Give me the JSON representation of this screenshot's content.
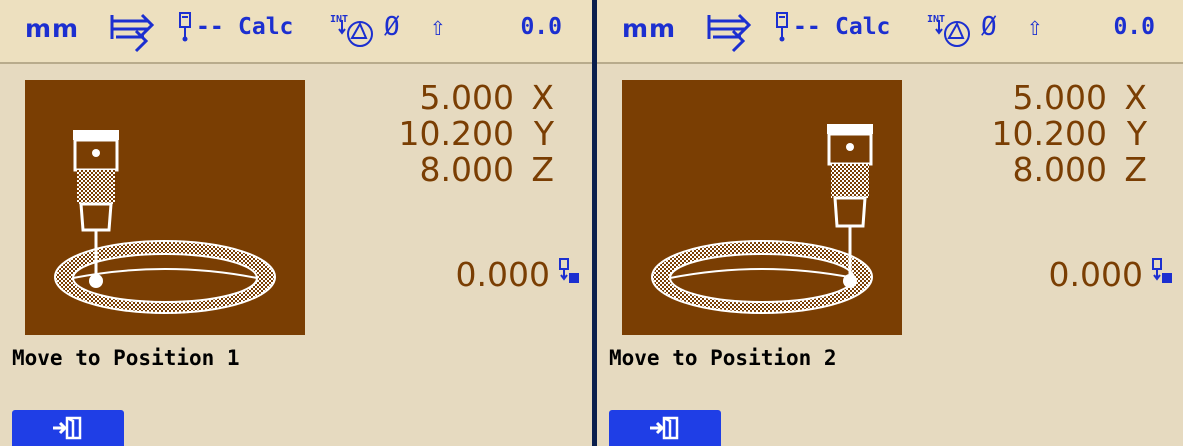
{
  "colors": {
    "panel_bg": "#e6dac0",
    "status_blue": "#1c2fd0",
    "readout_brown": "#7a3e03",
    "picture_bg": "#7a3e03",
    "softkey_blue": "#1f3ee6"
  },
  "panels": [
    {
      "status": {
        "unit": "mm",
        "probe_dashes": "--",
        "mode": "Calc",
        "int_label": "INT",
        "diameter_symbol": "Ø",
        "up_arrow": "⇧",
        "value": "0.0"
      },
      "readouts": {
        "x": {
          "value": "5.000",
          "axis": "X"
        },
        "y": {
          "value": "10.200",
          "axis": "Y"
        },
        "z": {
          "value": "8.000",
          "axis": "Z"
        },
        "tool_offset": "0.000"
      },
      "message": "Move to Position 1",
      "icons": {
        "feed": "feed-arrows-icon",
        "probe": "probe-icon",
        "round": "circle-probe-icon",
        "tool": "tool-offset-icon",
        "softkey": "exit-icon"
      }
    },
    {
      "status": {
        "unit": "mm",
        "probe_dashes": "--",
        "mode": "Calc",
        "int_label": "INT",
        "diameter_symbol": "Ø",
        "up_arrow": "⇧",
        "value": "0.0"
      },
      "readouts": {
        "x": {
          "value": "5.000",
          "axis": "X"
        },
        "y": {
          "value": "10.200",
          "axis": "Y"
        },
        "z": {
          "value": "8.000",
          "axis": "Z"
        },
        "tool_offset": "0.000"
      },
      "message": "Move to Position 2",
      "icons": {
        "feed": "feed-arrows-icon",
        "probe": "probe-icon",
        "round": "circle-probe-icon",
        "tool": "tool-offset-icon",
        "softkey": "exit-icon"
      }
    }
  ]
}
